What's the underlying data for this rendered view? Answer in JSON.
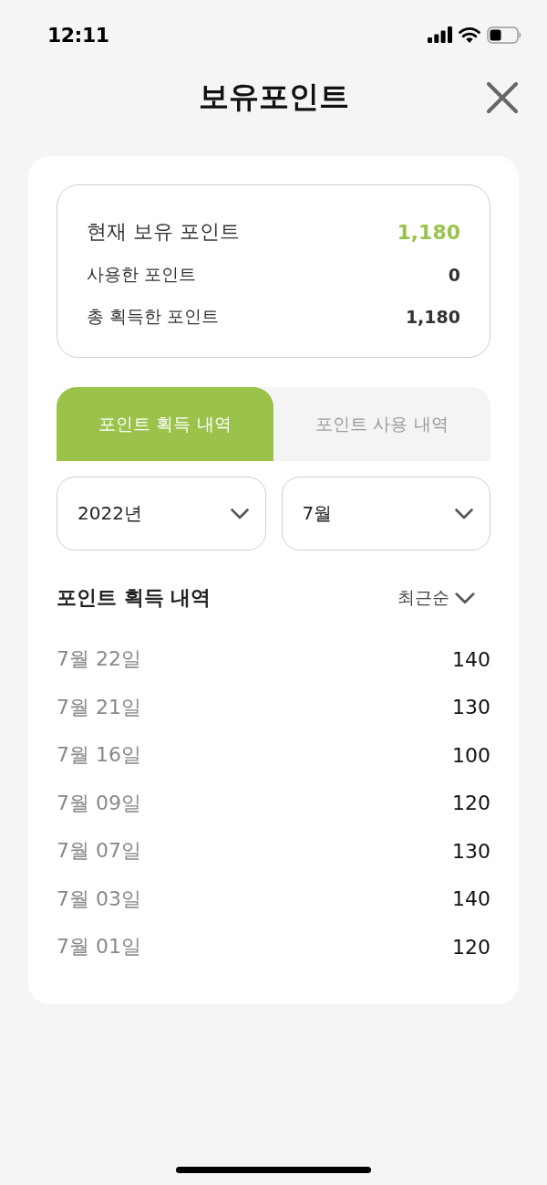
{
  "status_bar": {
    "time": "12:11"
  },
  "header": {
    "title": "보유포인트"
  },
  "summary": {
    "rows": [
      {
        "kind": "primary",
        "label": "현재 보유 포인트",
        "value": "1,180"
      },
      {
        "kind": "secondary",
        "label": "사용한 포인트",
        "value": "0"
      },
      {
        "kind": "secondary",
        "label": "총 획득한 포인트",
        "value": "1,180"
      }
    ]
  },
  "tabs": [
    {
      "label": "포인트 획득 내역",
      "selected": true
    },
    {
      "label": "포인트 사용 내역",
      "selected": false
    }
  ],
  "filters": [
    {
      "value": "2022년"
    },
    {
      "value": "7월"
    }
  ],
  "history": {
    "title": "포인트 획득 내역",
    "sort": "최근순",
    "rows": [
      {
        "date": "7월 22일",
        "points": "140"
      },
      {
        "date": "7월 21일",
        "points": "130"
      },
      {
        "date": "7월 16일",
        "points": "100"
      },
      {
        "date": "7월 09일",
        "points": "120"
      },
      {
        "date": "7월 07일",
        "points": "130"
      },
      {
        "date": "7월 03일",
        "points": "140"
      },
      {
        "date": "7월 01일",
        "points": "120"
      }
    ]
  }
}
